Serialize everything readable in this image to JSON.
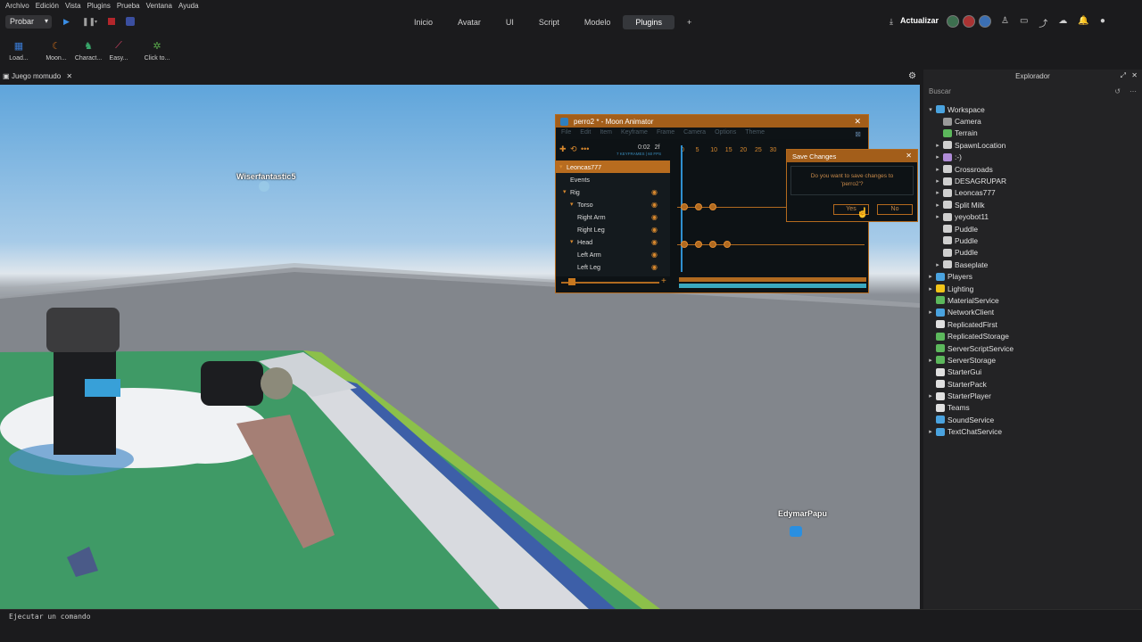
{
  "menubar": [
    "Archivo",
    "Edición",
    "Vista",
    "Plugins",
    "Prueba",
    "Ventana",
    "Ayuda"
  ],
  "toolbar": {
    "probar_label": "Probar",
    "tabs": [
      "Inicio",
      "Avatar",
      "UI",
      "Script",
      "Modelo",
      "Plugins",
      "+"
    ],
    "active_tab": "Plugins",
    "actualizar_label": "Actualizar"
  },
  "ribbon": {
    "plugins": [
      {
        "label": "Load...",
        "icon": "load-icon",
        "color": "#3a7bd5"
      },
      {
        "label": "Moon...",
        "icon": "moon-icon",
        "color": "#c0661a"
      },
      {
        "label": "Charact...",
        "icon": "character-icon",
        "color": "#39a86b"
      },
      {
        "label": "Easy...",
        "icon": "easy-icon",
        "color": "#e0466a"
      },
      {
        "label": "Click to...",
        "icon": "click-icon",
        "color": "#58a84a"
      }
    ]
  },
  "doc_tab": {
    "title": "Juego momudo"
  },
  "viewport": {
    "player_names": [
      "Wiserfantastic5",
      "EdymarPapu"
    ]
  },
  "moon_animator": {
    "title": "perro2 * - Moon Animator",
    "menu": [
      "File",
      "Edit",
      "Item",
      "Keyframe",
      "Frame",
      "Camera",
      "Options",
      "Theme"
    ],
    "time_readout": "0:02",
    "frame_readout": "2f",
    "fps_readout": "7 KEYFRAMES | 60 FPS",
    "ticks": [
      "0",
      "5",
      "10",
      "15",
      "20",
      "25",
      "30"
    ],
    "tracks": [
      {
        "label": "Leoncas777",
        "selected": true
      },
      {
        "label": "Events",
        "selected": false
      },
      {
        "label": "Rig",
        "selected": false
      },
      {
        "label": "Torso",
        "selected": false
      },
      {
        "label": "Right Arm",
        "selected": false
      },
      {
        "label": "Right Leg",
        "selected": false
      },
      {
        "label": "Head",
        "selected": false
      },
      {
        "label": "Left Arm",
        "selected": false
      },
      {
        "label": "Left Leg",
        "selected": false
      }
    ]
  },
  "save_dialog": {
    "title": "Save Changes",
    "message_line1": "Do you want to save changes to",
    "message_line2": "'perro2'?",
    "yes_label": "Yes",
    "no_label": "No"
  },
  "explorer": {
    "title": "Explorador",
    "search_placeholder": "Buscar",
    "items": [
      {
        "label": "Workspace",
        "depth": 0,
        "arrow": "▾",
        "color": "#4aa3df"
      },
      {
        "label": "Camera",
        "depth": 1,
        "arrow": "",
        "color": "#9a9a9a"
      },
      {
        "label": "Terrain",
        "depth": 1,
        "arrow": "",
        "color": "#5cb85c"
      },
      {
        "label": "SpawnLocation",
        "depth": 1,
        "arrow": "▸",
        "color": "#cfcfcf"
      },
      {
        "label": ":-)",
        "depth": 1,
        "arrow": "▸",
        "color": "#b08cd8"
      },
      {
        "label": "Crossroads",
        "depth": 1,
        "arrow": "▸",
        "color": "#cfcfcf"
      },
      {
        "label": "DESAGRUPAR",
        "depth": 1,
        "arrow": "▸",
        "color": "#cfcfcf"
      },
      {
        "label": "Leoncas777",
        "depth": 1,
        "arrow": "▸",
        "color": "#cfcfcf"
      },
      {
        "label": "Split Milk",
        "depth": 1,
        "arrow": "▸",
        "color": "#cfcfcf"
      },
      {
        "label": "yeyobot11",
        "depth": 1,
        "arrow": "▸",
        "color": "#cfcfcf"
      },
      {
        "label": "Puddle",
        "depth": 1,
        "arrow": "",
        "color": "#cfcfcf"
      },
      {
        "label": "Puddle",
        "depth": 1,
        "arrow": "",
        "color": "#cfcfcf"
      },
      {
        "label": "Puddle",
        "depth": 1,
        "arrow": "",
        "color": "#cfcfcf"
      },
      {
        "label": "Baseplate",
        "depth": 1,
        "arrow": "▸",
        "color": "#cfcfcf"
      },
      {
        "label": "Players",
        "depth": 0,
        "arrow": "▸",
        "color": "#4aa3df"
      },
      {
        "label": "Lighting",
        "depth": 0,
        "arrow": "▸",
        "color": "#f0c419"
      },
      {
        "label": "MaterialService",
        "depth": 0,
        "arrow": "",
        "color": "#5cb85c"
      },
      {
        "label": "NetworkClient",
        "depth": 0,
        "arrow": "▸",
        "color": "#4aa3df"
      },
      {
        "label": "ReplicatedFirst",
        "depth": 0,
        "arrow": "",
        "color": "#e0e0e0"
      },
      {
        "label": "ReplicatedStorage",
        "depth": 0,
        "arrow": "",
        "color": "#5cb85c"
      },
      {
        "label": "ServerScriptService",
        "depth": 0,
        "arrow": "",
        "color": "#5cb85c"
      },
      {
        "label": "ServerStorage",
        "depth": 0,
        "arrow": "▸",
        "color": "#5cb85c"
      },
      {
        "label": "StarterGui",
        "depth": 0,
        "arrow": "",
        "color": "#e0e0e0"
      },
      {
        "label": "StarterPack",
        "depth": 0,
        "arrow": "",
        "color": "#e0e0e0"
      },
      {
        "label": "StarterPlayer",
        "depth": 0,
        "arrow": "▸",
        "color": "#e0e0e0"
      },
      {
        "label": "Teams",
        "depth": 0,
        "arrow": "",
        "color": "#e0e0e0"
      },
      {
        "label": "SoundService",
        "depth": 0,
        "arrow": "",
        "color": "#4aa3df"
      },
      {
        "label": "TextChatService",
        "depth": 0,
        "arrow": "▸",
        "color": "#4aa3df"
      }
    ]
  },
  "command_bar": {
    "placeholder": "Ejecutar un comando"
  }
}
